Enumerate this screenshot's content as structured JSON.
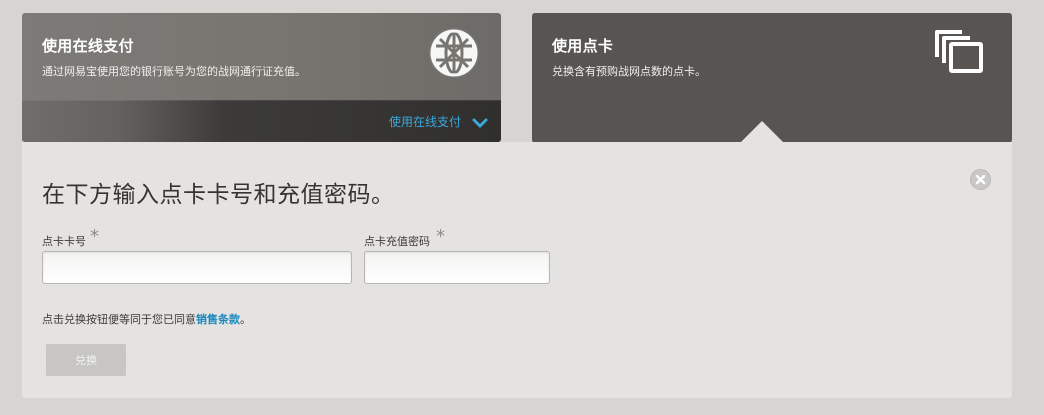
{
  "online_card": {
    "title": "使用在线支付",
    "description": "通过网易宝使用您的银行账号为您的战网通行证充值。",
    "action_label": "使用在线支付",
    "icon": "globe-icon"
  },
  "points_card": {
    "title": "使用点卡",
    "description": "兑换含有预购战网点数的点卡。",
    "icon": "cards-icon"
  },
  "panel": {
    "title": "在下方输入点卡卡号和充值密码。",
    "close_icon": "close-icon",
    "card_number": {
      "label": "点卡卡号",
      "required_mark": "*",
      "value": ""
    },
    "password": {
      "label": "点卡充值密码",
      "required_mark": "*",
      "value": ""
    },
    "terms_prefix": "点击兑换按钮便等同于您已同意",
    "terms_link": "销售条款",
    "terms_suffix": "。",
    "redeem_label": "兑换"
  },
  "colors": {
    "background": "#d6d5d2",
    "link_blue": "#39a8db",
    "panel": "#e4e3e1",
    "points_card": "#575452"
  }
}
